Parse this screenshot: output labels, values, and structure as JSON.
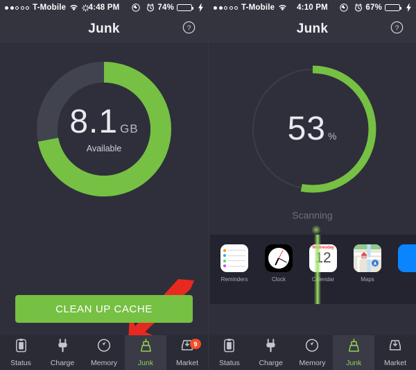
{
  "app": {
    "colors": {
      "background": "#2e2f3a",
      "accent_green": "#76c043",
      "track_gray": "#41434f",
      "badge_red": "#f2502a",
      "arrow_red": "#e8291f"
    }
  },
  "left_phone": {
    "status_bar": {
      "signal_dots": [
        true,
        true,
        false,
        false,
        false
      ],
      "carrier": "T-Mobile",
      "wifi_icon": "wifi-icon",
      "bluetooth_icon": "loading-icon",
      "time": "4:48 PM",
      "location_icon": "location-icon",
      "alarm_icon": "alarm-icon",
      "battery_percent": "74%",
      "battery_level": 74,
      "charging_icon": "bolt-icon"
    },
    "nav": {
      "title": "Junk",
      "help_icon": "help-circle-icon"
    },
    "gauge": {
      "value": "8.1",
      "unit": "GB",
      "caption": "Available",
      "green_fraction": 0.72,
      "type": "donut-thick"
    },
    "primary_button": {
      "label": "CLEAN UP CACHE"
    },
    "annotation": {
      "arrow_icon": "red-arrow-down-left-icon"
    },
    "tabs": [
      {
        "label": "Status",
        "icon": "clipboard-icon",
        "active": false,
        "badge": null
      },
      {
        "label": "Charge",
        "icon": "plug-icon",
        "active": false,
        "badge": null
      },
      {
        "label": "Memory",
        "icon": "gauge-icon",
        "active": false,
        "badge": null
      },
      {
        "label": "Junk",
        "icon": "broom-icon",
        "active": true,
        "badge": null
      },
      {
        "label": "Market",
        "icon": "download-box-icon",
        "active": false,
        "badge": "9"
      }
    ]
  },
  "right_phone": {
    "status_bar": {
      "signal_dots": [
        true,
        true,
        false,
        false,
        false
      ],
      "carrier": "T-Mobile",
      "wifi_icon": "wifi-icon",
      "time": "4:10 PM",
      "location_icon": "location-icon",
      "alarm_icon": "alarm-icon",
      "battery_percent": "67%",
      "battery_level": 67,
      "charging_icon": "bolt-icon"
    },
    "nav": {
      "title": "Junk",
      "help_icon": "help-circle-icon"
    },
    "gauge": {
      "value": "53",
      "unit": "%",
      "caption": "Scanning",
      "green_fraction": 0.53,
      "type": "donut-thin"
    },
    "scan_panel": {
      "beam_icon": "scan-beam-icon",
      "apps": [
        {
          "name": "Reminders",
          "icon": "reminders-app-icon"
        },
        {
          "name": "Clock",
          "icon": "clock-app-icon"
        },
        {
          "name": "Calendar",
          "icon": "calendar-app-icon",
          "day": "Wednesday",
          "date": "12"
        },
        {
          "name": "Maps",
          "icon": "maps-app-icon"
        }
      ]
    },
    "tabs": [
      {
        "label": "Status",
        "icon": "clipboard-icon",
        "active": false,
        "badge": null
      },
      {
        "label": "Charge",
        "icon": "plug-icon",
        "active": false,
        "badge": null
      },
      {
        "label": "Memory",
        "icon": "gauge-icon",
        "active": false,
        "badge": null
      },
      {
        "label": "Junk",
        "icon": "broom-icon",
        "active": true,
        "badge": null
      },
      {
        "label": "Market",
        "icon": "download-box-icon",
        "active": false,
        "badge": null
      }
    ]
  }
}
